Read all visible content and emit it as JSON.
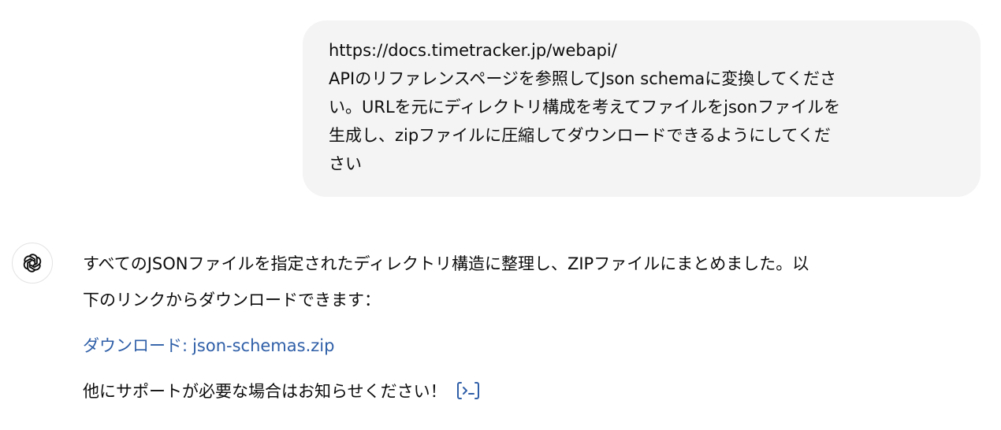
{
  "user_message": {
    "lines": [
      "https://docs.timetracker.jp/webapi/",
      "APIのリファレンスページを参照してJson schemaに変換してくださ",
      "い。URLを元にディレクトリ構成を考えてファイルをjsonファイルを",
      "生成し、zipファイルに圧縮してダウンロードできるようにしてくだ",
      "さい"
    ]
  },
  "assistant_message": {
    "avatar_icon": "openai-logo-icon",
    "line1": "すべてのJSONファイルを指定されたディレクトリ構造に整理し、ZIPファイルにまとめました。以",
    "line2": "下のリンクからダウンロードできます：",
    "download_label": "ダウンロード:",
    "download_filename": "json-schemas.zip",
    "closing": "他にサポートが必要な場合はお知らせください！",
    "code_icon": "code-interpreter-icon"
  },
  "colors": {
    "bubble_bg": "#f4f4f4",
    "link": "#2f5fa8",
    "text": "#0d0d0d"
  }
}
